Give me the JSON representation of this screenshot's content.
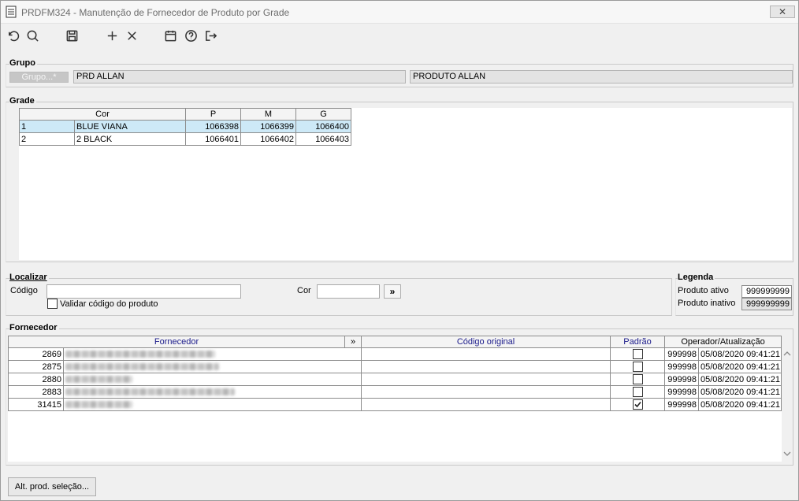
{
  "window": {
    "title": "PRDFM324 - Manutenção de Fornecedor de Produto por Grade",
    "close_glyph": "✕"
  },
  "toolbar": {
    "icons": [
      "undo-icon",
      "search-icon",
      "save-icon",
      "add-icon",
      "delete-icon",
      "calendar-icon",
      "help-icon",
      "exit-icon"
    ]
  },
  "grupo": {
    "title": "Grupo",
    "button_label": "Grupo...*",
    "code_value": "PRD ALLAN",
    "description_value": "PRODUTO ALLAN"
  },
  "grade": {
    "title": "Grade",
    "columns": [
      "Cor",
      "P",
      "M",
      "G"
    ],
    "rows": [
      {
        "num": "1",
        "cor": "BLUE VIANA",
        "p": "1066398",
        "m": "1066399",
        "g": "1066400"
      },
      {
        "num": "2",
        "cor": "2 BLACK",
        "p": "1066401",
        "m": "1066402",
        "g": "1066403"
      }
    ]
  },
  "localizar": {
    "title": "Localizar",
    "codigo_label": "Código",
    "codigo_value": "",
    "cor_label": "Cor",
    "cor_value": "",
    "go_glyph": "»",
    "validar_label": "Validar código do produto",
    "validar_checked": false
  },
  "legenda": {
    "title": "Legenda",
    "ativo_label": "Produto ativo",
    "ativo_value": "999999999",
    "inativo_label": "Produto inativo",
    "inativo_value": "999999999"
  },
  "fornecedor": {
    "title": "Fornecedor",
    "columns": {
      "fornecedor": "Fornecedor",
      "expand": "»",
      "codigo_original": "Código original",
      "padrao": "Padrão",
      "operador": "Operador/Atualização"
    },
    "rows": [
      {
        "code": "2869",
        "operador": "999998",
        "data": "05/08/2020 09:41:21",
        "padrao": false
      },
      {
        "code": "2875",
        "operador": "999998",
        "data": "05/08/2020 09:41:21",
        "padrao": false
      },
      {
        "code": "2880",
        "operador": "999998",
        "data": "05/08/2020 09:41:21",
        "padrao": false
      },
      {
        "code": "2883",
        "operador": "999998",
        "data": "05/08/2020 09:41:21",
        "padrao": false
      },
      {
        "code": "31415",
        "operador": "999998",
        "data": "05/08/2020 09:41:21",
        "padrao": true
      }
    ]
  },
  "footer": {
    "button_label": "Alt. prod. seleção..."
  }
}
